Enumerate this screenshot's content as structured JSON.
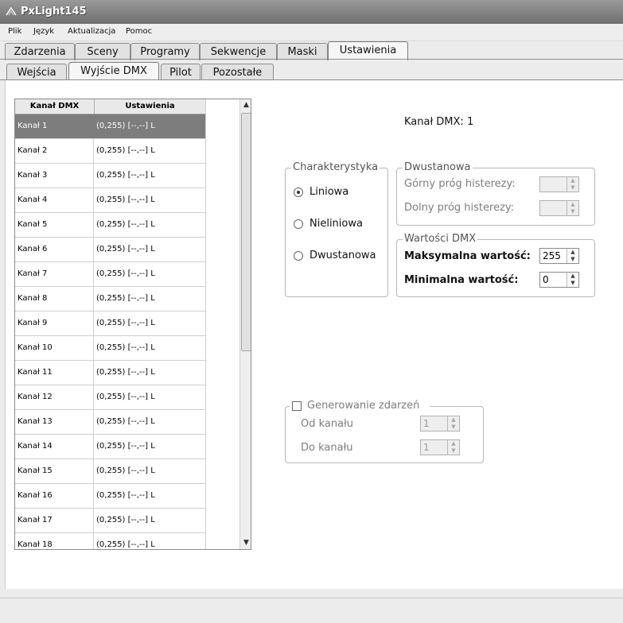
{
  "window": {
    "title": "PxLight145"
  },
  "menu": [
    "Plik",
    "Język",
    "Aktualizacja",
    "Pomoc"
  ],
  "tabs_main": [
    {
      "label": "Zdarzenia",
      "active": false
    },
    {
      "label": "Sceny",
      "active": false
    },
    {
      "label": "Programy",
      "active": false
    },
    {
      "label": "Sekwencje",
      "active": false
    },
    {
      "label": "Maski",
      "active": false
    },
    {
      "label": "Ustawienia",
      "active": true
    }
  ],
  "tabs_sub": [
    {
      "label": "Wejścia",
      "active": false
    },
    {
      "label": "Wyjście DMX",
      "active": true
    },
    {
      "label": "Pilot",
      "active": false
    },
    {
      "label": "Pozostałe",
      "active": false
    }
  ],
  "list": {
    "col1": "Kanał DMX",
    "col2": "Ustawienia",
    "rows": [
      {
        "channel": "Kanał 1",
        "settings": "(0,255) [--,--] L",
        "selected": true
      },
      {
        "channel": "Kanał 2",
        "settings": "(0,255) [--,--] L"
      },
      {
        "channel": "Kanał 3",
        "settings": "(0,255) [--,--] L"
      },
      {
        "channel": "Kanał 4",
        "settings": "(0,255) [--,--] L"
      },
      {
        "channel": "Kanał 5",
        "settings": "(0,255) [--,--] L"
      },
      {
        "channel": "Kanał 6",
        "settings": "(0,255) [--,--] L"
      },
      {
        "channel": "Kanał 7",
        "settings": "(0,255) [--,--] L"
      },
      {
        "channel": "Kanał 8",
        "settings": "(0,255) [--,--] L"
      },
      {
        "channel": "Kanał 9",
        "settings": "(0,255) [--,--] L"
      },
      {
        "channel": "Kanał 10",
        "settings": "(0,255) [--,--] L"
      },
      {
        "channel": "Kanał 11",
        "settings": "(0,255) [--,--] L"
      },
      {
        "channel": "Kanał 12",
        "settings": "(0,255) [--,--] L"
      },
      {
        "channel": "Kanał 13",
        "settings": "(0,255) [--,--] L"
      },
      {
        "channel": "Kanał 14",
        "settings": "(0,255) [--,--] L"
      },
      {
        "channel": "Kanał 15",
        "settings": "(0,255) [--,--] L"
      },
      {
        "channel": "Kanał 16",
        "settings": "(0,255) [--,--] L"
      },
      {
        "channel": "Kanał 17",
        "settings": "(0,255) [--,--] L"
      },
      {
        "channel": "Kanał 18",
        "settings": "(0,255) [--,--] L"
      }
    ]
  },
  "detail": {
    "channel_label": "Kanał DMX: 1",
    "characteristic": {
      "legend": "Charakterystyka",
      "options": [
        {
          "label": "Liniowa",
          "checked": true
        },
        {
          "label": "Nieliniowa",
          "checked": false
        },
        {
          "label": "Dwustanowa",
          "checked": false
        }
      ]
    },
    "twostate": {
      "legend": "Dwustanowa",
      "upper_label": "Górny próg histerezy:",
      "lower_label": "Dolny próg histerezy:",
      "upper_value": "",
      "lower_value": ""
    },
    "dmx_values": {
      "legend": "Wartości DMX",
      "max_label": "Maksymalna wartość:",
      "max_value": "255",
      "min_label": "Minimalna wartość:",
      "min_value": "0"
    },
    "events": {
      "checkbox_label": "Generowanie zdarzeń",
      "checked": false,
      "from_label": "Od kanału",
      "to_label": "Do kanału",
      "from_value": "1",
      "to_value": "1"
    }
  }
}
